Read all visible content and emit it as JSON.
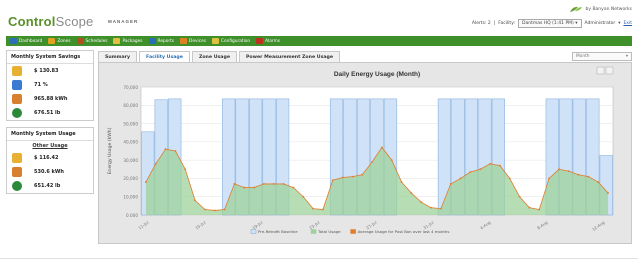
{
  "header": {
    "logo_main": "Control",
    "logo_accent": "Scope",
    "logo_sub": "MANAGER",
    "brand": "by Banyan Networks",
    "alerts_label": "Alerts: 2",
    "facility_label": "Facility:",
    "facility_value": "Dantmas HQ (1:41 PM)",
    "user_label": "Administrator",
    "logout": "Exit"
  },
  "nav": {
    "items": [
      {
        "label": "Dashboard",
        "color": "#2a6db8"
      },
      {
        "label": "Zones",
        "color": "#e0a020"
      },
      {
        "label": "Schedules",
        "color": "#b05020"
      },
      {
        "label": "Packages",
        "color": "#e0c040"
      },
      {
        "label": "Reports",
        "color": "#2a6db8"
      },
      {
        "label": "Devices",
        "color": "#e08020"
      },
      {
        "label": "Configuration",
        "color": "#e0c040"
      },
      {
        "label": "Alarms",
        "color": "#c03020"
      }
    ]
  },
  "savings": {
    "title": "Monthly System Savings",
    "items": [
      {
        "value": "$ 130.83",
        "icon": "money-icon",
        "color": "#e8b030"
      },
      {
        "value": "71 %",
        "icon": "chart-icon",
        "color": "#3a7ad0"
      },
      {
        "value": "965.88 kWh",
        "icon": "meter-icon",
        "color": "#d88030"
      },
      {
        "value": "676.51 lb",
        "icon": "co2-icon",
        "color": "#2a8a3a"
      }
    ]
  },
  "usage": {
    "title": "Monthly System Usage",
    "other_label": "Other Usage",
    "items": [
      {
        "value": "$ 116.42",
        "icon": "money-icon",
        "color": "#e8b030"
      },
      {
        "value": "530.6 kWh",
        "icon": "meter-icon",
        "color": "#d88030"
      },
      {
        "value": "651.42 lb",
        "icon": "co2-icon",
        "color": "#2a8a3a"
      }
    ]
  },
  "tabs": [
    {
      "label": "Summary",
      "active": false
    },
    {
      "label": "Facility Usage",
      "active": true
    },
    {
      "label": "Zone Usage",
      "active": false
    },
    {
      "label": "Power Measurement Zone Usage",
      "active": false
    }
  ],
  "period_select": "Month",
  "colors": {
    "bar_fill": "#cfe2f7",
    "bar_stroke": "#7aa7d8",
    "area_fill": "#9ed19a",
    "line": "#e07c2a"
  },
  "chart_data": {
    "type": "bar",
    "title": "Daily Energy Usage (Month)",
    "ylabel": "Energy Usage (kWh)",
    "ylim": [
      0,
      70000
    ],
    "yticks": [
      0,
      10000,
      20000,
      30000,
      40000,
      50000,
      60000,
      70000
    ],
    "ytick_labels": [
      "0.000",
      "10,000",
      "20,000",
      "30,000",
      "40,000",
      "50,000",
      "60,000",
      "70,000"
    ],
    "xtick_labels": [
      "11-Jul",
      "15-Jul",
      "19-Jul",
      "23-Jul",
      "27-Jul",
      "31-Jul",
      "4-Aug",
      "8-Aug",
      "12-Aug"
    ],
    "series": [
      {
        "name": "Pre-Retrofit Baseline",
        "kind": "bar",
        "values": [
          45500,
          63000,
          63500,
          0,
          0,
          0,
          63500,
          63500,
          63500,
          63500,
          63500,
          0,
          0,
          0,
          63500,
          63500,
          63500,
          63500,
          63500,
          0,
          0,
          0,
          63500,
          63500,
          63500,
          63500,
          63500,
          0,
          0,
          0,
          63500,
          63500,
          63500,
          63500,
          32500
        ]
      },
      {
        "name": "Total Usage",
        "kind": "area",
        "values": [
          18000,
          28000,
          36000,
          35000,
          25000,
          8000,
          3000,
          2500,
          3000,
          17000,
          15000,
          15000,
          17000,
          17000,
          17000,
          15000,
          10000,
          3500,
          3000,
          19000,
          20500,
          21000,
          22000,
          29000,
          37000,
          30000,
          18000,
          12000,
          7000,
          4000,
          3500,
          17000,
          20000,
          23500,
          25000,
          28000,
          27000,
          20000,
          10000,
          4000,
          3000,
          20000,
          25000,
          24000,
          22000,
          21000,
          18000,
          12000
        ]
      },
      {
        "name": "Average Usage for Post Ban over last 4 months",
        "kind": "line",
        "values": [
          18000,
          28000,
          36000,
          35000,
          25000,
          8000,
          3000,
          2500,
          3000,
          17000,
          15000,
          15000,
          17000,
          17000,
          17000,
          15000,
          10000,
          3500,
          3000,
          19000,
          20500,
          21000,
          22000,
          29000,
          37000,
          30000,
          18000,
          12000,
          7000,
          4000,
          3500,
          17000,
          20000,
          23500,
          25000,
          28000,
          27000,
          20000,
          10000,
          4000,
          3000,
          20000,
          25000,
          24000,
          22000,
          21000,
          18000,
          12000
        ]
      }
    ]
  }
}
